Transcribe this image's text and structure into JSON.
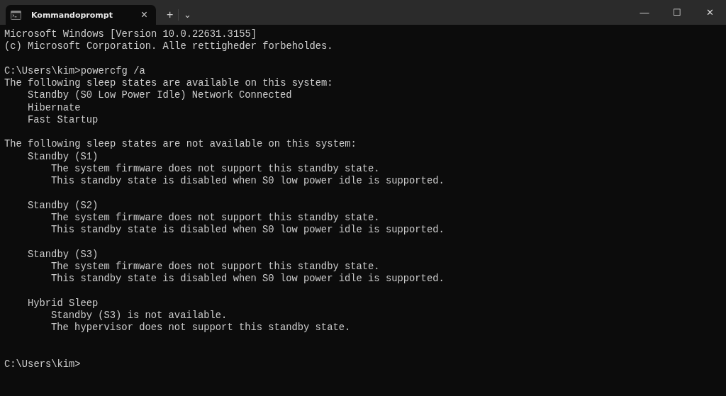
{
  "tab": {
    "title": "Kommandoprompt",
    "close": "×",
    "selected": true
  },
  "tab_actions": {
    "new_tab": "+",
    "dropdown": "⌄"
  },
  "window_controls": {
    "minimize": "—",
    "maximize": "☐",
    "close": "✕"
  },
  "console": {
    "blocks": [
      [
        {
          "text": "Microsoft Windows [Version 10.0.22631.3155]"
        },
        {
          "text": "(c) Microsoft Corporation. Alle rettigheder forbeholdes."
        }
      ],
      [
        {
          "text": "C:\\Users\\kim>powercfg /a"
        },
        {
          "text": "The following sleep states are available on this system:",
          "children": [
            {
              "text": "Standby (S0 Low Power Idle) Network Connected"
            },
            {
              "text": "Hibernate"
            },
            {
              "text": "Fast Startup"
            }
          ]
        }
      ],
      [
        {
          "text": "The following sleep states are not available on this system:",
          "children": [
            {
              "text": "Standby (S1)",
              "children": [
                {
                  "text": "The system firmware does not support this standby state."
                },
                {
                  "text": "This standby state is disabled when S0 low power idle is supported."
                }
              ]
            },
            {
              "text": "Standby (S2)",
              "children": [
                {
                  "text": "The system firmware does not support this standby state."
                },
                {
                  "text": "This standby state is disabled when S0 low power idle is supported."
                }
              ]
            },
            {
              "text": "Standby (S3)",
              "children": [
                {
                  "text": "The system firmware does not support this standby state."
                },
                {
                  "text": "This standby state is disabled when S0 low power idle is supported."
                }
              ]
            },
            {
              "text": "Hybrid Sleep",
              "children": [
                {
                  "text": "Standby (S3) is not available."
                },
                {
                  "text": "The hypervisor does not support this standby state."
                }
              ]
            }
          ]
        }
      ]
    ],
    "prompt": "C:\\Users\\kim>"
  }
}
